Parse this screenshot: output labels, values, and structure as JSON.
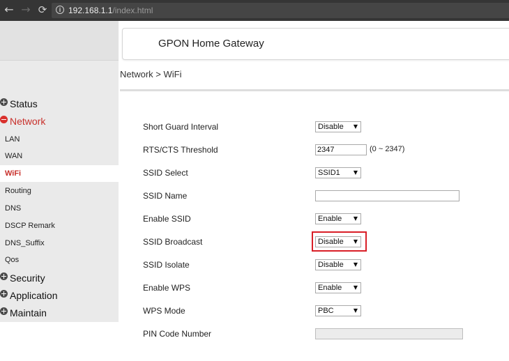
{
  "browser": {
    "url_host": "192.168.1.1",
    "url_path": "/index.html",
    "back_icon": "←",
    "forward_icon": "→",
    "reload_icon": "⟳",
    "info_icon": "i"
  },
  "header": {
    "title": "GPON Home Gateway"
  },
  "breadcrumb": "Network > WiFi",
  "sidebar": {
    "categories": {
      "status": "Status",
      "network": "Network",
      "security": "Security",
      "application": "Application",
      "maintain": "Maintain"
    },
    "network_items": {
      "lan": "LAN",
      "wan": "WAN",
      "wifi": "WiFi",
      "routing": "Routing",
      "dns": "DNS",
      "dscp": "DSCP Remark",
      "dns_suffix": "DNS_Suffix",
      "qos": "Qos"
    },
    "selected_item": "WiFi"
  },
  "form": {
    "short_guard_interval": {
      "label": "Short Guard Interval",
      "value": "Disable"
    },
    "rts_cts_threshold": {
      "label": "RTS/CTS Threshold",
      "value": "2347",
      "hint": "(0 ~ 2347)"
    },
    "ssid_select": {
      "label": "SSID Select",
      "value": "SSID1"
    },
    "ssid_name": {
      "label": "SSID Name",
      "value": ""
    },
    "enable_ssid": {
      "label": "Enable SSID",
      "value": "Enable"
    },
    "ssid_broadcast": {
      "label": "SSID Broadcast",
      "value": "Disable"
    },
    "ssid_isolate": {
      "label": "SSID Isolate",
      "value": "Disable"
    },
    "enable_wps": {
      "label": "Enable WPS",
      "value": "Enable"
    },
    "wps_mode": {
      "label": "WPS Mode",
      "value": "PBC"
    },
    "pin_code_number": {
      "label": "PIN Code Number",
      "value": ""
    }
  },
  "colors": {
    "accent_red": "#c8302b",
    "highlight_red": "#d91e27",
    "sidebar_bg": "#eaeaea"
  },
  "icons": {
    "expand": "plus-circle-icon",
    "collapse": "minus-circle-icon",
    "dropdown": "caret-down-icon"
  },
  "dropdown_caret": "▼"
}
